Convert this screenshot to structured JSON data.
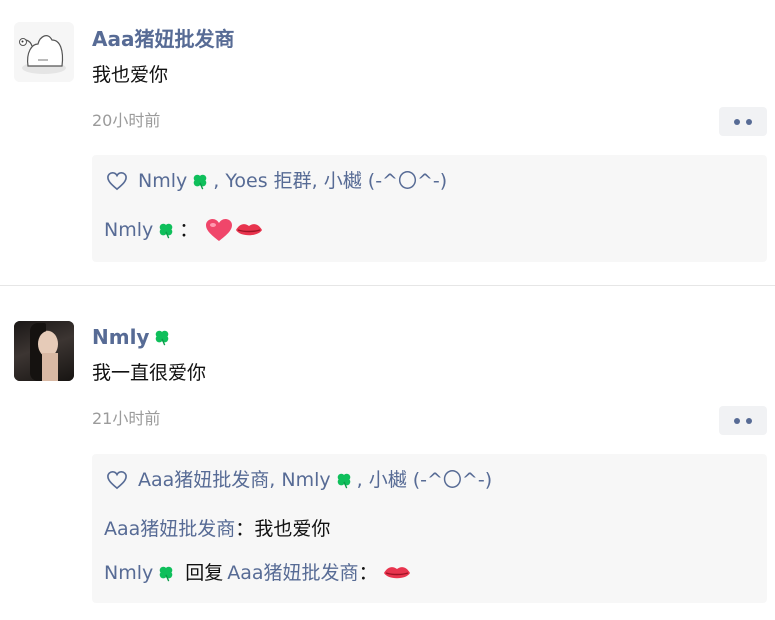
{
  "posts": [
    {
      "author": "Aaa猪妞批发商",
      "content": "我也爱你",
      "time": "20小时前",
      "likes": {
        "text": "Nmly , Yoes 拒群, 小樾 (-^〇^-)",
        "parts": [
          "Nmly",
          ", Yoes 拒群, 小樾 (-^〇^-)"
        ]
      },
      "comments": [
        {
          "author": "Nmly",
          "separator": "：",
          "emoji": [
            "heart",
            "lips"
          ]
        }
      ]
    },
    {
      "author": "Nmly",
      "content": "我一直很爱你",
      "time": "21小时前",
      "likes": {
        "parts": [
          "Aaa猪妞批发商, Nmly",
          ", 小樾 (-^〇^-)"
        ]
      },
      "comments": [
        {
          "author": "Aaa猪妞批发商",
          "separator": "：",
          "text": "我也爱你"
        },
        {
          "author": "Nmly",
          "reply_word": "回复",
          "reply_to": "Aaa猪妞批发商",
          "separator": "：",
          "emoji": [
            "lips"
          ]
        }
      ]
    }
  ],
  "icons": {
    "like": "heart-outline-icon",
    "clover": "four-leaf-clover-icon",
    "more": "more-dots-icon"
  },
  "colors": {
    "name_link": "#576b95",
    "time": "#9b9b9b",
    "box_bg": "#f7f7f7",
    "clover": "#0fbf5b"
  }
}
